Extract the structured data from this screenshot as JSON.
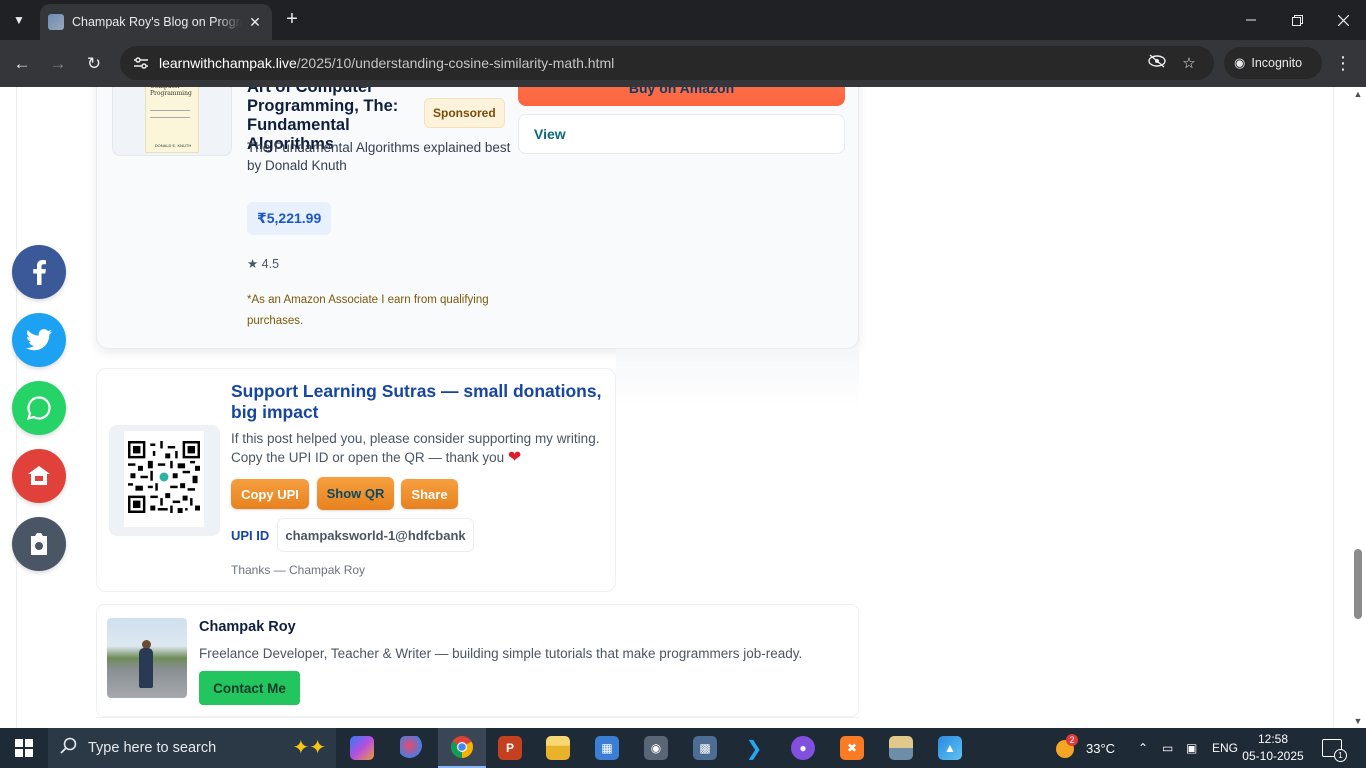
{
  "browser": {
    "tab_title": "Champak Roy's Blog on Programming",
    "url_host": "learnwithchampak.live",
    "url_path": "/2025/10/understanding-cosine-similarity-math.html",
    "incognito_label": "Incognito"
  },
  "product": {
    "title": "Art of Computer Programming, The: Fundamental Algorithms",
    "sponsored": "Sponsored",
    "description": "The Fundamental Algorithms explained best by Donald Knuth",
    "price": "₹5,221.99",
    "rating": "★ 4.5",
    "disclaimer": "*As an Amazon Associate I earn from qualifying purchases.",
    "buy_label": "Buy on Amazon",
    "view_label": "View",
    "cover_title": "The Art of Computer Programming",
    "cover_author": "DONALD E. KNUTH"
  },
  "donation": {
    "title": "Support Learning Sutras — small donations, big impact",
    "text": "If this post helped you, please consider supporting my writing. Copy the UPI ID or open the QR — thank you",
    "copy_upi": "Copy UPI",
    "show_qr": "Show QR",
    "share": "Share",
    "upi_label": "UPI ID",
    "upi_id": "champaksworld-1@hdfcbank",
    "thanks": "Thanks — Champak Roy"
  },
  "author": {
    "name": "Champak Roy",
    "bio": "Freelance Developer, Teacher & Writer — building simple tutorials that make programmers job-ready.",
    "contact_label": "Contact Me"
  },
  "share_sidebar": [
    {
      "name": "facebook",
      "color": "#3b5998"
    },
    {
      "name": "twitter",
      "color": "#1da1f2"
    },
    {
      "name": "whatsapp",
      "color": "#25d366"
    },
    {
      "name": "home",
      "color": "#e0413a"
    },
    {
      "name": "save",
      "color": "#4a5566"
    }
  ],
  "taskbar": {
    "search_placeholder": "Type here to search",
    "weather_temp": "33°C",
    "weather_badge": "2",
    "language": "ENG",
    "time": "12:58",
    "date": "05-10-2025",
    "notification_count": "1"
  }
}
